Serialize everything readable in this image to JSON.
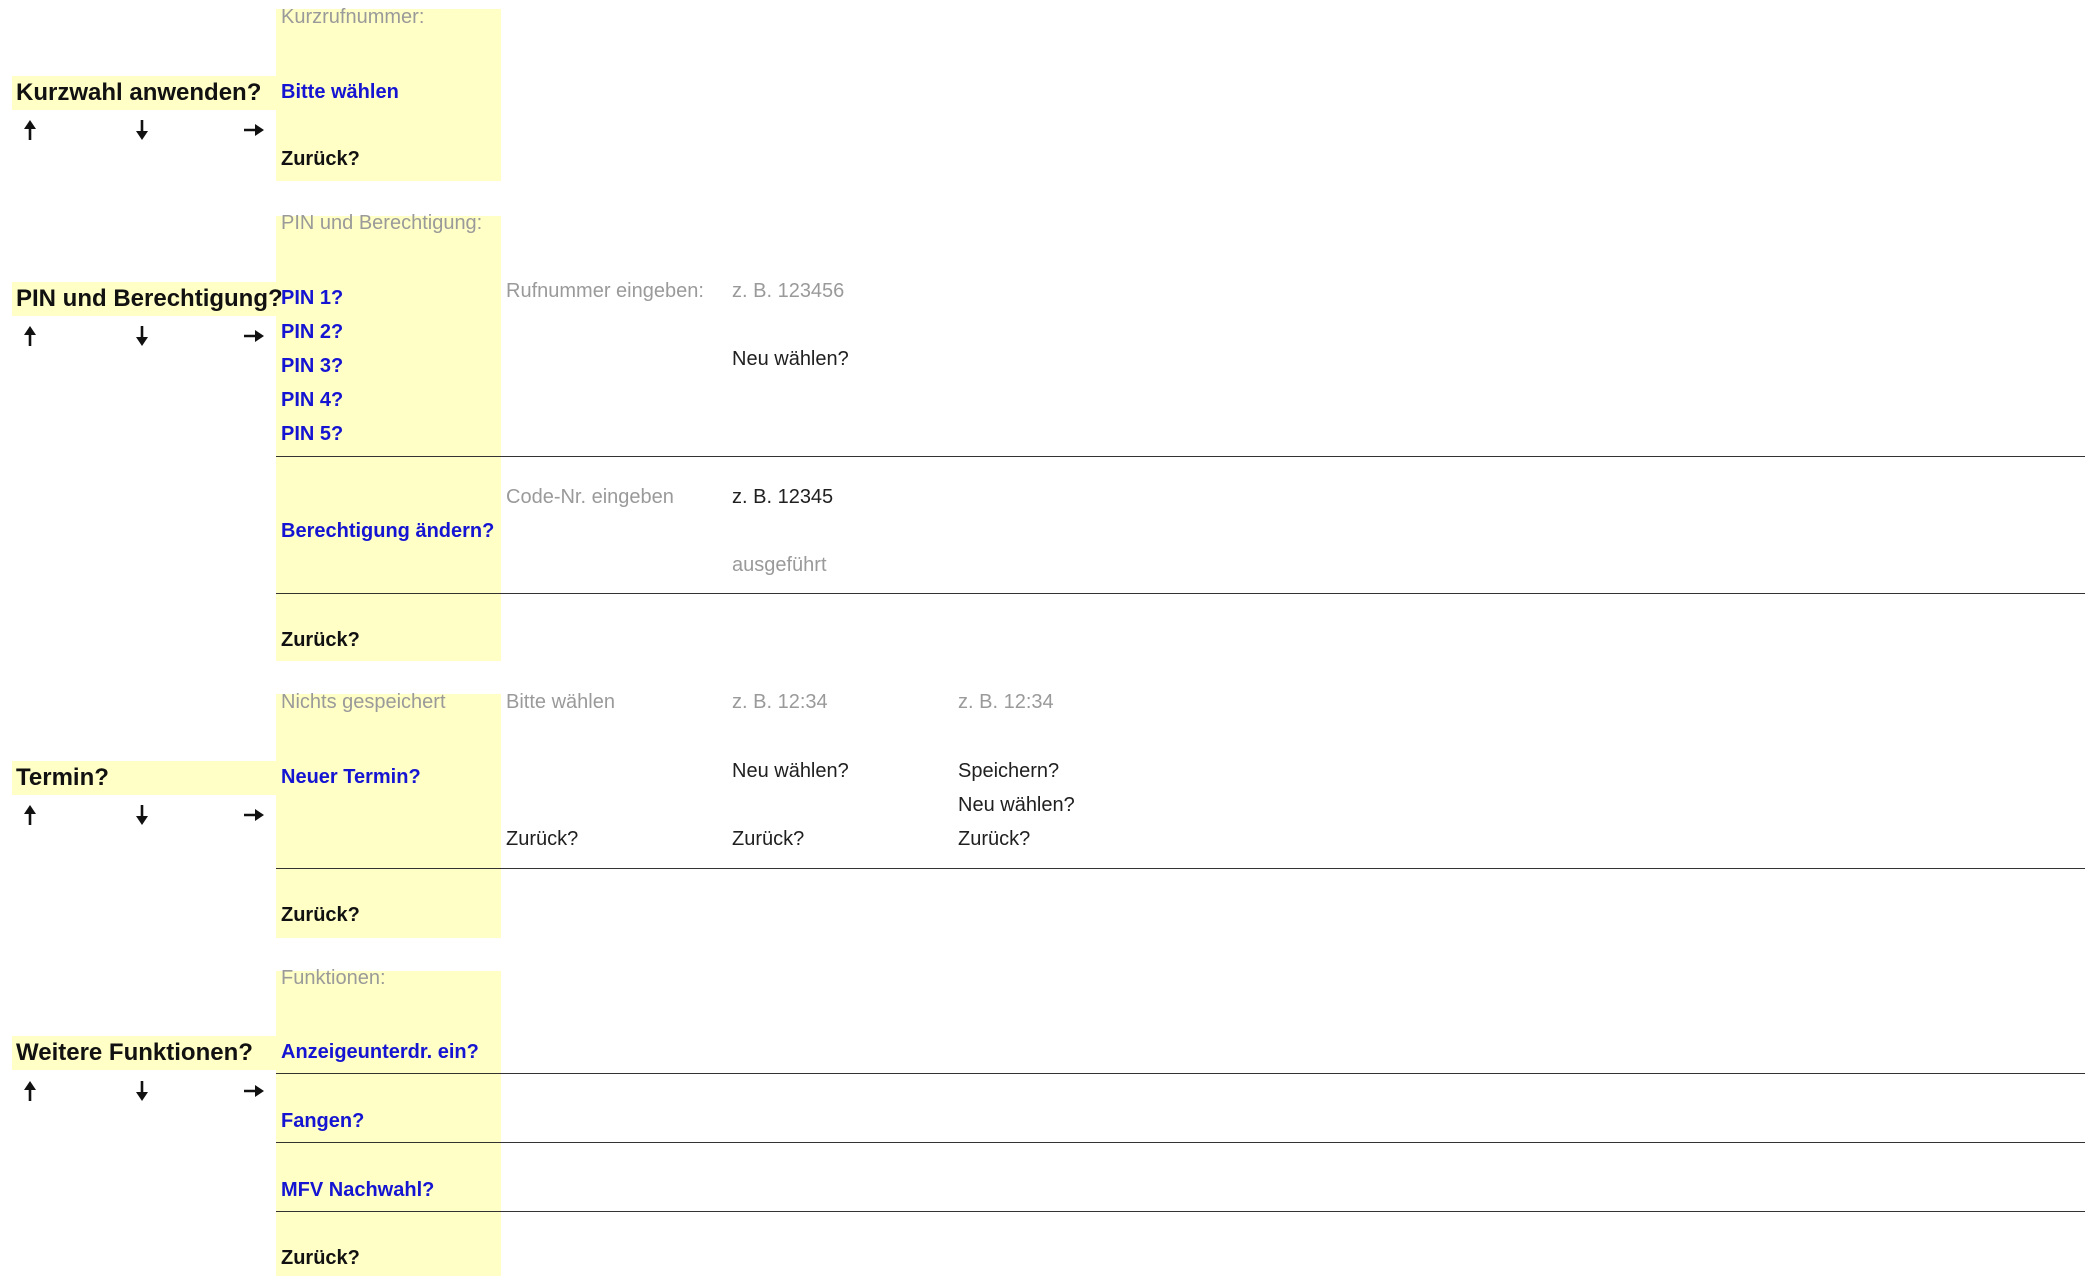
{
  "colors": {
    "highlight_bg": "#ffffc6",
    "option_text": "#1414d2",
    "hint_text": "#9a9a9a",
    "body_text": "#202020"
  },
  "nav_icons": [
    "arrow-up-icon",
    "arrow-down-icon",
    "arrow-right-icon"
  ],
  "kurzwahl": {
    "label": "Kurzwahl anwenden?",
    "header": "Kurzrufnummer:",
    "option": "Bitte wählen",
    "back": "Zurück?"
  },
  "pin": {
    "label": "PIN und Berechtigung?",
    "header": "PIN und Berechtigung:",
    "options": [
      "PIN 1?",
      "PIN 2?",
      "PIN 3?",
      "PIN 4?",
      "PIN 5?"
    ],
    "enter_number": "Rufnummer eingeben:",
    "example_number": "z. B. 123456",
    "reselect": "Neu wählen?",
    "change_authorization": "Berechtigung ändern?",
    "enter_code": "Code-Nr. eingeben",
    "example_code": "z. B. 12345",
    "done": "ausgeführt",
    "back": "Zurück?"
  },
  "termin": {
    "label": "Termin?",
    "header": "Nichts gespeichert",
    "option": "Neuer Termin?",
    "please_select": "Bitte wählen",
    "example_time_1": "z. B. 12:34",
    "example_time_2": "z. B. 12:34",
    "reselect_1": "Neu wählen?",
    "save": "Speichern?",
    "reselect_2": "Neu wählen?",
    "back_col2": "Zurück?",
    "back_col3": "Zurück?",
    "back_col4": "Zurück?",
    "back": "Zurück?"
  },
  "weitere": {
    "label": "Weitere Funktionen?",
    "header": "Funktionen:",
    "options": [
      "Anzeigeunterdr. ein?",
      "Fangen?",
      "MFV Nachwahl?"
    ],
    "back": "Zurück?"
  }
}
